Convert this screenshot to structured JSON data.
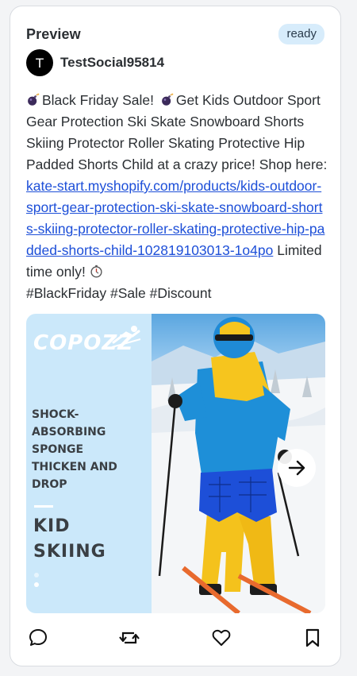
{
  "header": {
    "title": "Preview",
    "status": "ready"
  },
  "account": {
    "avatar_initial": "T",
    "name": "TestSocial95814"
  },
  "post": {
    "emoji_1": "bomb-emoji",
    "text_1": "Black Friday Sale!",
    "emoji_2": "bomb-emoji",
    "text_2": "Get Kids Outdoor Sport Gear Protection Ski Skate Snowboard Shorts Skiing Protector Roller Skating Protective Hip Padded Shorts Child at a crazy price! Shop here:",
    "link": "kate-start.myshopify.com/products/kids-outdoor-sport-gear-protection-ski-skate-snowboard-shorts-skiing-protector-roller-skating-protective-hip-padded-shorts-child-102819103013-1o4po",
    "text_3": "Limited time only!",
    "emoji_3": "stopwatch-emoji",
    "hashtags": "#BlackFriday #Sale #Discount"
  },
  "media": {
    "brand": "COPOZZ",
    "tagline_1": "SHOCK-ABSORBING",
    "tagline_2": "SPONGE",
    "tagline_3": "THICKEN AND DROP",
    "headline_1": "KID",
    "headline_2": "SKIING",
    "carousel_position": 1,
    "carousel_count": 2,
    "next_icon": "arrow-right-icon"
  },
  "actions": {
    "comment_icon": "comment-icon",
    "repost_icon": "repost-icon",
    "like_icon": "heart-icon",
    "bookmark_icon": "bookmark-icon"
  },
  "colors": {
    "badge_bg": "#d7ecfb",
    "link": "#1d4fd8",
    "media_panel": "#cbe8fa"
  }
}
